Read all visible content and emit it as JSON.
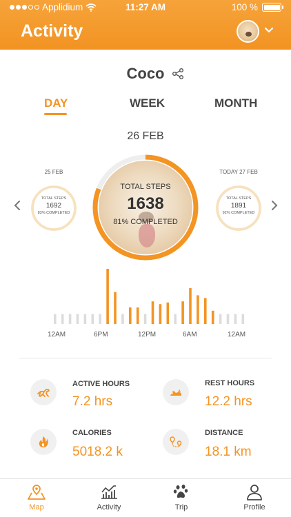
{
  "status_bar": {
    "carrier": "Applidium",
    "time": "11:27 AM",
    "battery": "100 %",
    "battery_level": 1.0
  },
  "header": {
    "title": "Activity",
    "avatar_icon": "dog-avatar",
    "menu_icon": "chevron-down-icon"
  },
  "pet": {
    "name": "Coco",
    "share_icon": "share-icon"
  },
  "tabs": [
    {
      "label": "DAY",
      "active": true
    },
    {
      "label": "WEEK",
      "active": false
    },
    {
      "label": "MONTH",
      "active": false
    }
  ],
  "current_date": "26 FEB",
  "rings": {
    "prev": {
      "date": "25 FEB",
      "title": "TOTAL STEPS",
      "steps": "1692",
      "completed": "83% COMPLETED",
      "progress": 0.83
    },
    "current": {
      "title": "TOTAL STEPS",
      "steps": "1638",
      "completed": "81% COMPLETED",
      "progress": 0.81
    },
    "next": {
      "date": "TODAY 27 FEB",
      "title": "TOTAL STEPS",
      "steps": "1891",
      "completed": "92% COMPLETED",
      "progress": 0.92
    }
  },
  "chart_data": {
    "type": "bar",
    "title": "",
    "xlabel": "",
    "ylabel": "",
    "x_tick_labels": [
      "12AM",
      "6PM",
      "12PM",
      "6AM",
      "12AM"
    ],
    "values": [
      0.18,
      0.18,
      0.18,
      0.18,
      0.18,
      0.18,
      0.18,
      1.0,
      0.58,
      0.18,
      0.3,
      0.3,
      0.18,
      0.41,
      0.36,
      0.39,
      0.18,
      0.41,
      0.65,
      0.52,
      0.47,
      0.24,
      0.18,
      0.18,
      0.18,
      0.18
    ],
    "active": [
      false,
      false,
      false,
      false,
      false,
      false,
      false,
      true,
      true,
      false,
      true,
      true,
      false,
      true,
      true,
      true,
      false,
      true,
      true,
      true,
      true,
      true,
      false,
      false,
      false,
      false
    ],
    "active_color": "#f39423",
    "inactive_color": "#dcdcdc"
  },
  "stats": [
    {
      "label": "ACTIVE HOURS",
      "value": "7.2 hrs",
      "icon": "running-dog-icon"
    },
    {
      "label": "REST HOURS",
      "value": "12.2 hrs",
      "icon": "resting-dog-icon"
    },
    {
      "label": "CALORIES",
      "value": "5018.2 k",
      "icon": "flame-icon"
    },
    {
      "label": "DISTANCE",
      "value": "18.1 km",
      "icon": "route-pin-icon"
    }
  ],
  "nav": [
    {
      "label": "Map",
      "icon": "map-icon",
      "active": true
    },
    {
      "label": "Activity",
      "icon": "activity-chart-icon",
      "active": false
    },
    {
      "label": "Trip",
      "icon": "paw-icon",
      "active": false
    },
    {
      "label": "Profile",
      "icon": "profile-icon",
      "active": false
    }
  ],
  "colors": {
    "accent": "#f39423",
    "header_bg": "#f5a030",
    "ring_track": "#eeeeee",
    "small_ring": "#f7e1bd"
  }
}
